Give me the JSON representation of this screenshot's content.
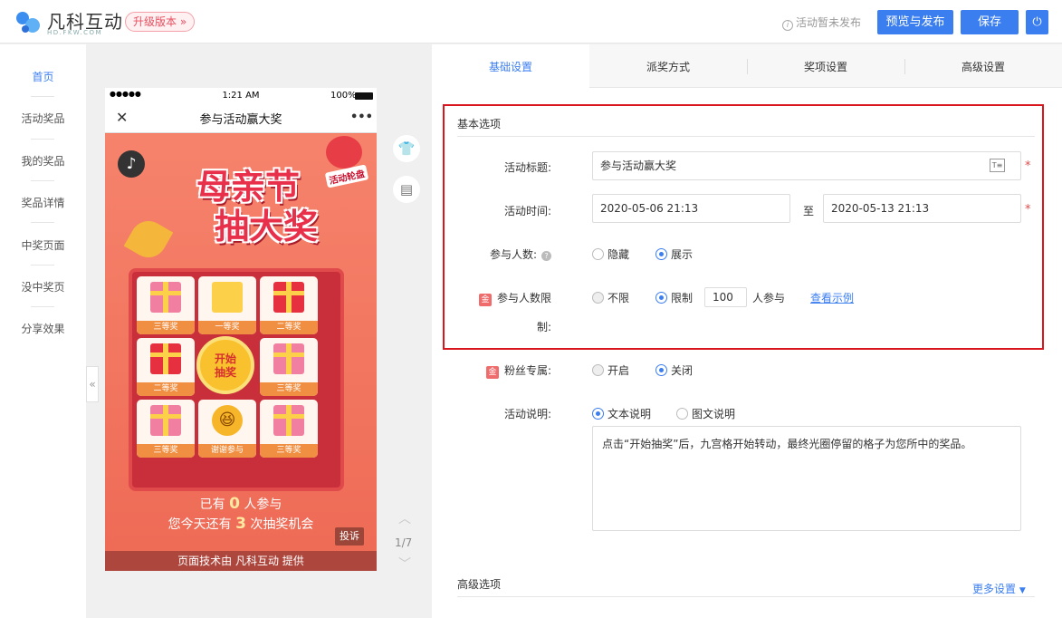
{
  "header": {
    "logo_name": "凡科互动",
    "logo_url": "HD.FKW.COM",
    "upgrade_label": "升级版本 »",
    "status_text": "活动暂未发布",
    "preview_button": "预览与发布",
    "save_button": "保存",
    "power_icon": "power-icon"
  },
  "nav": {
    "items": [
      {
        "label": "首页",
        "active": true
      },
      {
        "label": "活动奖品"
      },
      {
        "label": "我的奖品"
      },
      {
        "label": "奖品详情"
      },
      {
        "label": "中奖页面"
      },
      {
        "label": "没中奖页"
      },
      {
        "label": "分享效果"
      }
    ],
    "collapse": "«"
  },
  "phone": {
    "status_left": "●●●●●",
    "time": "1:21 AM",
    "battery": "100%",
    "close": "✕",
    "title": "参与活动赢大奖",
    "more": "•••",
    "poster_title_1": "母亲节",
    "poster_title_2": "抽大奖",
    "sticker": "活动轮盘",
    "prizes": [
      "三等奖",
      "一等奖",
      "二等奖",
      "二等奖",
      "三等奖",
      "三等奖",
      "谢谢参与",
      "三等奖"
    ],
    "draw_button_1": "开始",
    "draw_button_2": "抽奖",
    "participants_pre": "已有",
    "participants": "0",
    "participants_post": "人参与",
    "chances_pre": "您今天还有",
    "chances": "3",
    "chances_post": "次抽奖机会",
    "report": "投诉",
    "footer": "页面技术由 凡科互动 提供"
  },
  "pager": {
    "text": "1/7"
  },
  "tabs": [
    {
      "label": "基础设置",
      "active": true
    },
    {
      "label": "派奖方式"
    },
    {
      "label": "奖项设置"
    },
    {
      "label": "高级设置"
    }
  ],
  "form": {
    "section_basic": "基本选项",
    "title_label": "活动标题:",
    "title_value": "参与活动赢大奖",
    "time_label": "活动时间:",
    "time_start": "2020-05-06 21:13",
    "time_to": "至",
    "time_end": "2020-05-13 21:13",
    "count_label": "参与人数:",
    "count_hide": "隐藏",
    "count_show": "展示",
    "limit_label_1": "参与人数限",
    "limit_label_2": "制:",
    "limit_none": "不限",
    "limit_on": "限制",
    "limit_value": "100",
    "limit_unit": "人参与",
    "limit_example": "查看示例",
    "fans_label": "粉丝专属:",
    "fans_open": "开启",
    "fans_close": "关闭",
    "desc_label": "活动说明:",
    "desc_text_opt": "文本说明",
    "desc_rich_opt": "图文说明",
    "desc_value": "点击“开始抽奖”后，九宫格开始转动，最终光圈停留的格子为您所中的奖品。",
    "section_adv": "高级选项",
    "more_settings": "更多设置",
    "badge": "金",
    "required": "*"
  }
}
